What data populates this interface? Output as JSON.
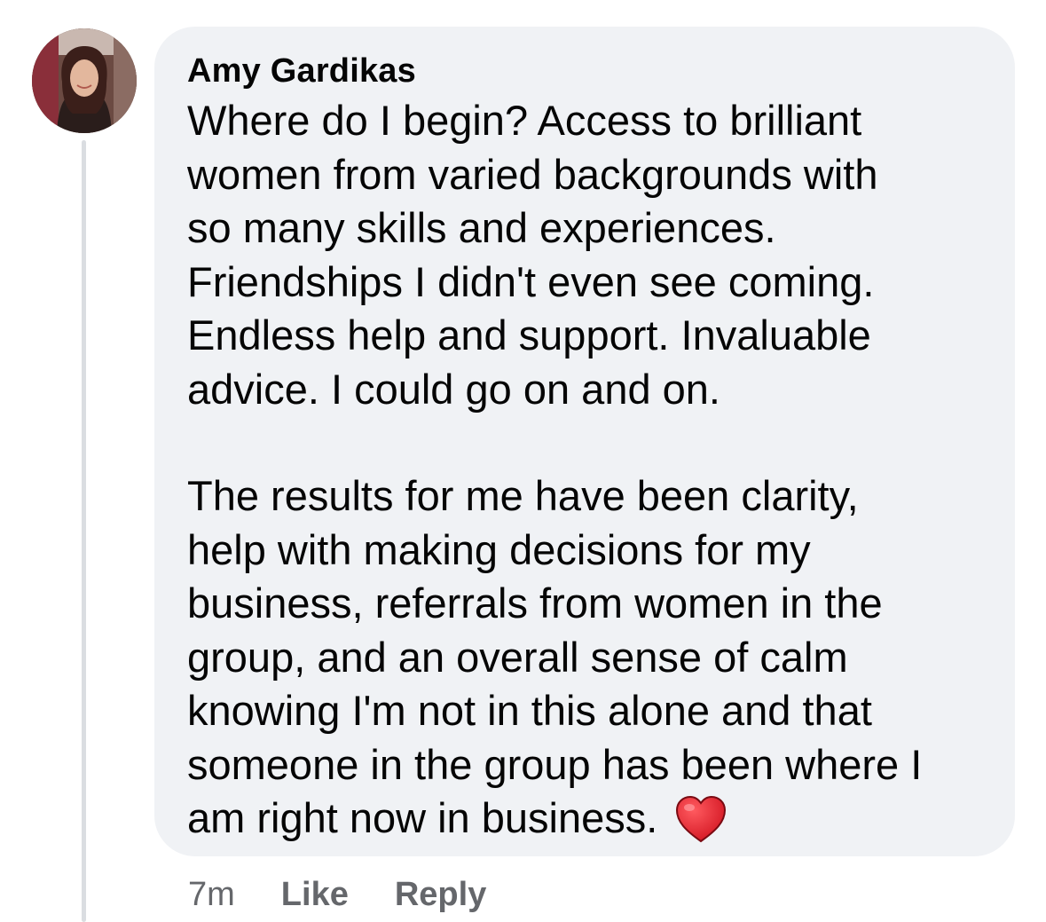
{
  "comment": {
    "author": "Amy Gardikas",
    "paragraphs": [
      "Where do I begin? Access to brilliant\nwomen from varied backgrounds with\nso many skills and experiences.\nFriendships I didn't even see coming.\nEndless help and support. Invaluable\nadvice. I could go on and on.",
      "The results for me have been clarity,\nhelp with making decisions for my\nbusiness, referrals from women in the\ngroup, and an overall sense of calm\nknowing I'm not in this alone and that\nsomeone in the group has been where I\nam right now in business."
    ],
    "emoji": "red-heart",
    "timestamp": "7m",
    "actions": {
      "like": "Like",
      "reply": "Reply"
    }
  },
  "colors": {
    "bubble_background": "#f0f2f5",
    "text": "#050505",
    "secondary_text": "#65676b",
    "heart": "#e0202e"
  }
}
